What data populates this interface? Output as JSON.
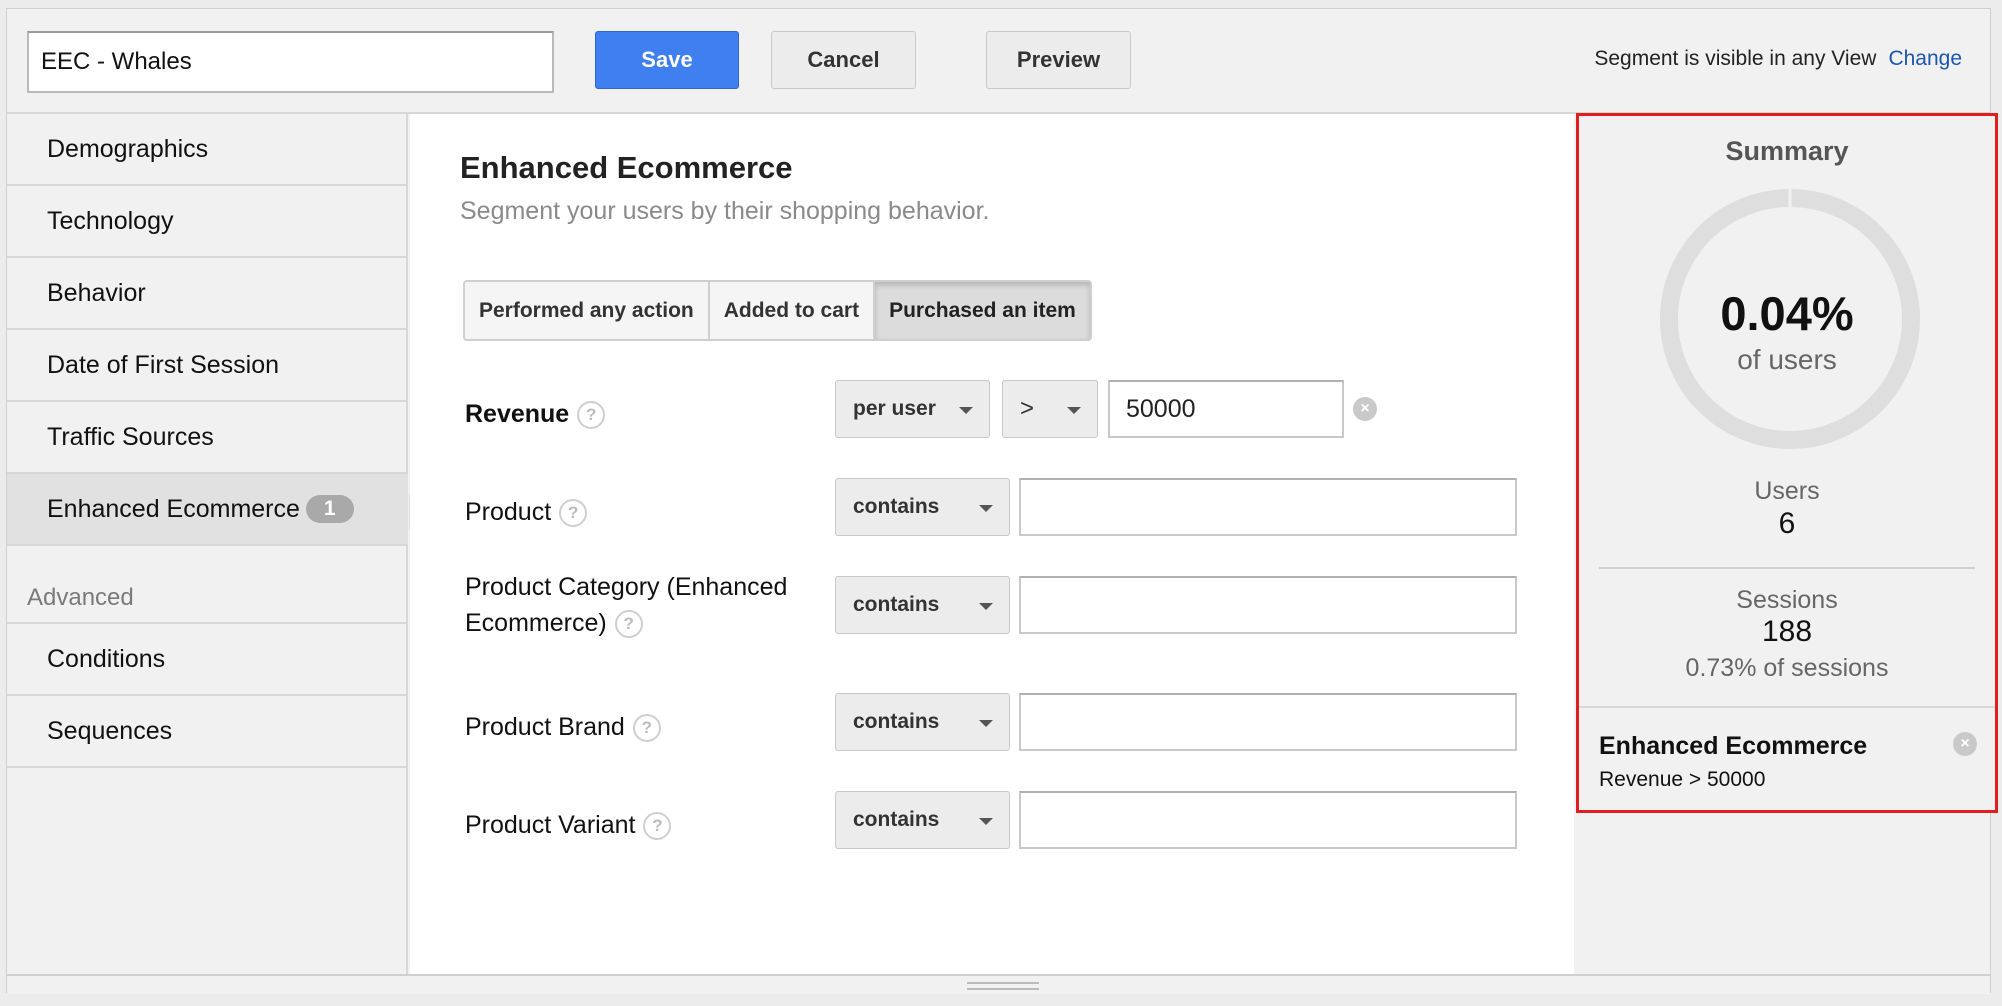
{
  "topbar": {
    "segment_name": "EEC - Whales",
    "save_label": "Save",
    "cancel_label": "Cancel",
    "preview_label": "Preview",
    "visibility_text": "Segment is visible in any View",
    "change_label": "Change"
  },
  "sidebar": {
    "items": [
      {
        "label": "Demographics"
      },
      {
        "label": "Technology"
      },
      {
        "label": "Behavior"
      },
      {
        "label": "Date of First Session"
      },
      {
        "label": "Traffic Sources"
      },
      {
        "label": "Enhanced Ecommerce",
        "badge": "1"
      }
    ],
    "advanced_label": "Advanced",
    "advanced_items": [
      {
        "label": "Conditions"
      },
      {
        "label": "Sequences"
      }
    ]
  },
  "main": {
    "title": "Enhanced Ecommerce",
    "subtitle": "Segment your users by their shopping behavior.",
    "tabs": [
      "Performed any action",
      "Added to cart",
      "Purchased an item"
    ],
    "revenue": {
      "label": "Revenue",
      "scope": "per user",
      "operator": ">",
      "value": "50000"
    },
    "filters": [
      {
        "label": "Product",
        "operator": "contains",
        "value": ""
      },
      {
        "label_line1": "Product Category (Enhanced",
        "label_line2": "Ecommerce)",
        "operator": "contains",
        "value": ""
      },
      {
        "label": "Product Brand",
        "operator": "contains",
        "value": ""
      },
      {
        "label": "Product Variant",
        "operator": "contains",
        "value": ""
      }
    ],
    "help_glyph": "?"
  },
  "summary": {
    "title": "Summary",
    "percent": "0.04%",
    "percent_label": "of users",
    "percent_fraction": 0.0004,
    "users_label": "Users",
    "users_value": "6",
    "sessions_label": "Sessions",
    "sessions_value": "188",
    "sessions_pct": "0.73% of sessions",
    "condition_title": "Enhanced Ecommerce",
    "condition_text": "Revenue > 50000"
  },
  "icons": {
    "clear": "×",
    "help": "question-circle-icon"
  },
  "colors": {
    "save_button": "#3f7ff0",
    "link": "#1a56b0",
    "highlight_border": "#e01e1e"
  }
}
